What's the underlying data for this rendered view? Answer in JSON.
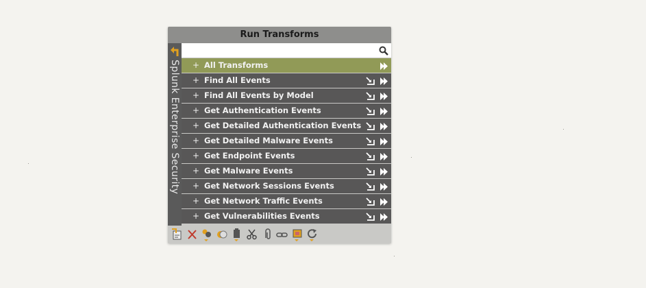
{
  "panel": {
    "title": "Run Transforms",
    "side_label": "Splunk Enterprise Security",
    "search": {
      "value": "",
      "placeholder": ""
    }
  },
  "transforms": [
    {
      "label": "All Transforms",
      "selected": true
    },
    {
      "label": "Find All Events",
      "selected": false
    },
    {
      "label": "Find All Events by Model",
      "selected": false
    },
    {
      "label": "Get Authentication Events",
      "selected": false
    },
    {
      "label": "Get Detailed Authentication Events",
      "selected": false
    },
    {
      "label": "Get Detailed Malware Events",
      "selected": false
    },
    {
      "label": "Get Endpoint Events",
      "selected": false
    },
    {
      "label": "Get Malware Events",
      "selected": false
    },
    {
      "label": "Get Network Sessions Events",
      "selected": false
    },
    {
      "label": "Get Network Traffic Events",
      "selected": false
    },
    {
      "label": "Get Vulnerabilities Events",
      "selected": false
    }
  ],
  "row_prefix": "+",
  "toolbar": [
    "clear-graph-icon",
    "delete-icon",
    "color-picker-icon",
    "toggle-icon",
    "paste-icon",
    "cut-icon",
    "attach-icon",
    "link-icon",
    "layout-icon",
    "refresh-icon"
  ],
  "colors": {
    "title_bar": "#8e8e8c",
    "row": "#585757",
    "row_selected": "#919a57",
    "accent": "#e0a020"
  }
}
